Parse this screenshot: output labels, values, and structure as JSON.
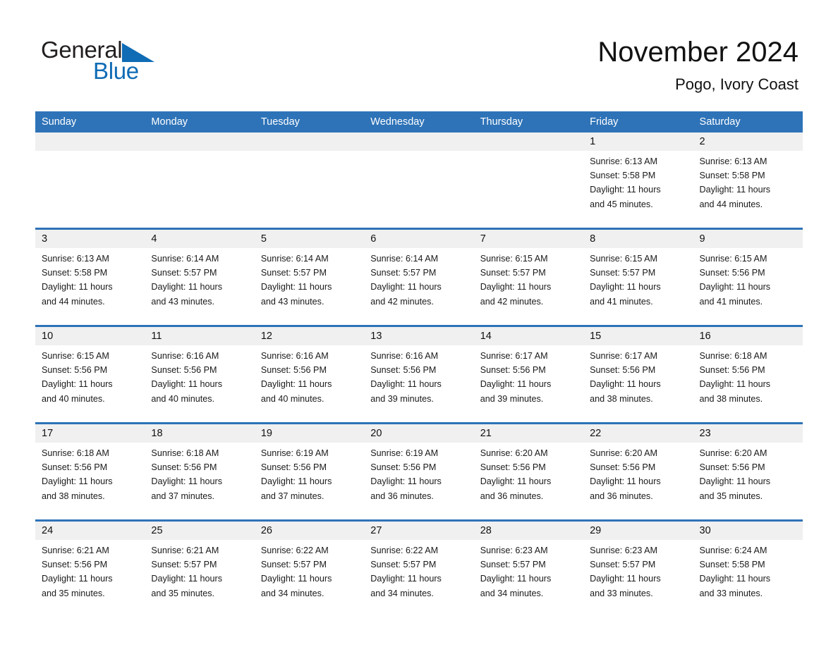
{
  "brand": {
    "word_top": "General",
    "word_bottom": "Blue",
    "triangle_icon": "blue-triangle-icon",
    "color_text": "#231f20",
    "color_blue": "#0f6cb5"
  },
  "header": {
    "title": "November 2024",
    "subtitle": "Pogo, Ivory Coast"
  },
  "theme": {
    "header_blue": "#2e73b8",
    "row_divider_blue": "#2e73b8",
    "daynum_band": "#f0f0f0",
    "page_background": "#ffffff",
    "text": "#1a1a1a"
  },
  "weekdays": [
    "Sunday",
    "Monday",
    "Tuesday",
    "Wednesday",
    "Thursday",
    "Friday",
    "Saturday"
  ],
  "weeks": [
    {
      "days": [
        {
          "number": "",
          "lines": []
        },
        {
          "number": "",
          "lines": []
        },
        {
          "number": "",
          "lines": []
        },
        {
          "number": "",
          "lines": []
        },
        {
          "number": "",
          "lines": []
        },
        {
          "number": "1",
          "sunrise": "6:13 AM",
          "sunset": "5:58 PM",
          "daylight": "11 hours and 45 minutes.",
          "lines": [
            "Sunrise: 6:13 AM",
            "Sunset: 5:58 PM",
            "Daylight: 11 hours",
            "and 45 minutes."
          ]
        },
        {
          "number": "2",
          "sunrise": "6:13 AM",
          "sunset": "5:58 PM",
          "daylight": "11 hours and 44 minutes.",
          "lines": [
            "Sunrise: 6:13 AM",
            "Sunset: 5:58 PM",
            "Daylight: 11 hours",
            "and 44 minutes."
          ]
        }
      ]
    },
    {
      "days": [
        {
          "number": "3",
          "sunrise": "6:13 AM",
          "sunset": "5:58 PM",
          "daylight": "11 hours and 44 minutes.",
          "lines": [
            "Sunrise: 6:13 AM",
            "Sunset: 5:58 PM",
            "Daylight: 11 hours",
            "and 44 minutes."
          ]
        },
        {
          "number": "4",
          "sunrise": "6:14 AM",
          "sunset": "5:57 PM",
          "daylight": "11 hours and 43 minutes.",
          "lines": [
            "Sunrise: 6:14 AM",
            "Sunset: 5:57 PM",
            "Daylight: 11 hours",
            "and 43 minutes."
          ]
        },
        {
          "number": "5",
          "sunrise": "6:14 AM",
          "sunset": "5:57 PM",
          "daylight": "11 hours and 43 minutes.",
          "lines": [
            "Sunrise: 6:14 AM",
            "Sunset: 5:57 PM",
            "Daylight: 11 hours",
            "and 43 minutes."
          ]
        },
        {
          "number": "6",
          "sunrise": "6:14 AM",
          "sunset": "5:57 PM",
          "daylight": "11 hours and 42 minutes.",
          "lines": [
            "Sunrise: 6:14 AM",
            "Sunset: 5:57 PM",
            "Daylight: 11 hours",
            "and 42 minutes."
          ]
        },
        {
          "number": "7",
          "sunrise": "6:15 AM",
          "sunset": "5:57 PM",
          "daylight": "11 hours and 42 minutes.",
          "lines": [
            "Sunrise: 6:15 AM",
            "Sunset: 5:57 PM",
            "Daylight: 11 hours",
            "and 42 minutes."
          ]
        },
        {
          "number": "8",
          "sunrise": "6:15 AM",
          "sunset": "5:57 PM",
          "daylight": "11 hours and 41 minutes.",
          "lines": [
            "Sunrise: 6:15 AM",
            "Sunset: 5:57 PM",
            "Daylight: 11 hours",
            "and 41 minutes."
          ]
        },
        {
          "number": "9",
          "sunrise": "6:15 AM",
          "sunset": "5:56 PM",
          "daylight": "11 hours and 41 minutes.",
          "lines": [
            "Sunrise: 6:15 AM",
            "Sunset: 5:56 PM",
            "Daylight: 11 hours",
            "and 41 minutes."
          ]
        }
      ]
    },
    {
      "days": [
        {
          "number": "10",
          "sunrise": "6:15 AM",
          "sunset": "5:56 PM",
          "daylight": "11 hours and 40 minutes.",
          "lines": [
            "Sunrise: 6:15 AM",
            "Sunset: 5:56 PM",
            "Daylight: 11 hours",
            "and 40 minutes."
          ]
        },
        {
          "number": "11",
          "sunrise": "6:16 AM",
          "sunset": "5:56 PM",
          "daylight": "11 hours and 40 minutes.",
          "lines": [
            "Sunrise: 6:16 AM",
            "Sunset: 5:56 PM",
            "Daylight: 11 hours",
            "and 40 minutes."
          ]
        },
        {
          "number": "12",
          "sunrise": "6:16 AM",
          "sunset": "5:56 PM",
          "daylight": "11 hours and 40 minutes.",
          "lines": [
            "Sunrise: 6:16 AM",
            "Sunset: 5:56 PM",
            "Daylight: 11 hours",
            "and 40 minutes."
          ]
        },
        {
          "number": "13",
          "sunrise": "6:16 AM",
          "sunset": "5:56 PM",
          "daylight": "11 hours and 39 minutes.",
          "lines": [
            "Sunrise: 6:16 AM",
            "Sunset: 5:56 PM",
            "Daylight: 11 hours",
            "and 39 minutes."
          ]
        },
        {
          "number": "14",
          "sunrise": "6:17 AM",
          "sunset": "5:56 PM",
          "daylight": "11 hours and 39 minutes.",
          "lines": [
            "Sunrise: 6:17 AM",
            "Sunset: 5:56 PM",
            "Daylight: 11 hours",
            "and 39 minutes."
          ]
        },
        {
          "number": "15",
          "sunrise": "6:17 AM",
          "sunset": "5:56 PM",
          "daylight": "11 hours and 38 minutes.",
          "lines": [
            "Sunrise: 6:17 AM",
            "Sunset: 5:56 PM",
            "Daylight: 11 hours",
            "and 38 minutes."
          ]
        },
        {
          "number": "16",
          "sunrise": "6:18 AM",
          "sunset": "5:56 PM",
          "daylight": "11 hours and 38 minutes.",
          "lines": [
            "Sunrise: 6:18 AM",
            "Sunset: 5:56 PM",
            "Daylight: 11 hours",
            "and 38 minutes."
          ]
        }
      ]
    },
    {
      "days": [
        {
          "number": "17",
          "sunrise": "6:18 AM",
          "sunset": "5:56 PM",
          "daylight": "11 hours and 38 minutes.",
          "lines": [
            "Sunrise: 6:18 AM",
            "Sunset: 5:56 PM",
            "Daylight: 11 hours",
            "and 38 minutes."
          ]
        },
        {
          "number": "18",
          "sunrise": "6:18 AM",
          "sunset": "5:56 PM",
          "daylight": "11 hours and 37 minutes.",
          "lines": [
            "Sunrise: 6:18 AM",
            "Sunset: 5:56 PM",
            "Daylight: 11 hours",
            "and 37 minutes."
          ]
        },
        {
          "number": "19",
          "sunrise": "6:19 AM",
          "sunset": "5:56 PM",
          "daylight": "11 hours and 37 minutes.",
          "lines": [
            "Sunrise: 6:19 AM",
            "Sunset: 5:56 PM",
            "Daylight: 11 hours",
            "and 37 minutes."
          ]
        },
        {
          "number": "20",
          "sunrise": "6:19 AM",
          "sunset": "5:56 PM",
          "daylight": "11 hours and 36 minutes.",
          "lines": [
            "Sunrise: 6:19 AM",
            "Sunset: 5:56 PM",
            "Daylight: 11 hours",
            "and 36 minutes."
          ]
        },
        {
          "number": "21",
          "sunrise": "6:20 AM",
          "sunset": "5:56 PM",
          "daylight": "11 hours and 36 minutes.",
          "lines": [
            "Sunrise: 6:20 AM",
            "Sunset: 5:56 PM",
            "Daylight: 11 hours",
            "and 36 minutes."
          ]
        },
        {
          "number": "22",
          "sunrise": "6:20 AM",
          "sunset": "5:56 PM",
          "daylight": "11 hours and 36 minutes.",
          "lines": [
            "Sunrise: 6:20 AM",
            "Sunset: 5:56 PM",
            "Daylight: 11 hours",
            "and 36 minutes."
          ]
        },
        {
          "number": "23",
          "sunrise": "6:20 AM",
          "sunset": "5:56 PM",
          "daylight": "11 hours and 35 minutes.",
          "lines": [
            "Sunrise: 6:20 AM",
            "Sunset: 5:56 PM",
            "Daylight: 11 hours",
            "and 35 minutes."
          ]
        }
      ]
    },
    {
      "days": [
        {
          "number": "24",
          "sunrise": "6:21 AM",
          "sunset": "5:56 PM",
          "daylight": "11 hours and 35 minutes.",
          "lines": [
            "Sunrise: 6:21 AM",
            "Sunset: 5:56 PM",
            "Daylight: 11 hours",
            "and 35 minutes."
          ]
        },
        {
          "number": "25",
          "sunrise": "6:21 AM",
          "sunset": "5:57 PM",
          "daylight": "11 hours and 35 minutes.",
          "lines": [
            "Sunrise: 6:21 AM",
            "Sunset: 5:57 PM",
            "Daylight: 11 hours",
            "and 35 minutes."
          ]
        },
        {
          "number": "26",
          "sunrise": "6:22 AM",
          "sunset": "5:57 PM",
          "daylight": "11 hours and 34 minutes.",
          "lines": [
            "Sunrise: 6:22 AM",
            "Sunset: 5:57 PM",
            "Daylight: 11 hours",
            "and 34 minutes."
          ]
        },
        {
          "number": "27",
          "sunrise": "6:22 AM",
          "sunset": "5:57 PM",
          "daylight": "11 hours and 34 minutes.",
          "lines": [
            "Sunrise: 6:22 AM",
            "Sunset: 5:57 PM",
            "Daylight: 11 hours",
            "and 34 minutes."
          ]
        },
        {
          "number": "28",
          "sunrise": "6:23 AM",
          "sunset": "5:57 PM",
          "daylight": "11 hours and 34 minutes.",
          "lines": [
            "Sunrise: 6:23 AM",
            "Sunset: 5:57 PM",
            "Daylight: 11 hours",
            "and 34 minutes."
          ]
        },
        {
          "number": "29",
          "sunrise": "6:23 AM",
          "sunset": "5:57 PM",
          "daylight": "11 hours and 33 minutes.",
          "lines": [
            "Sunrise: 6:23 AM",
            "Sunset: 5:57 PM",
            "Daylight: 11 hours",
            "and 33 minutes."
          ]
        },
        {
          "number": "30",
          "sunrise": "6:24 AM",
          "sunset": "5:58 PM",
          "daylight": "11 hours and 33 minutes.",
          "lines": [
            "Sunrise: 6:24 AM",
            "Sunset: 5:58 PM",
            "Daylight: 11 hours",
            "and 33 minutes."
          ]
        }
      ]
    }
  ]
}
